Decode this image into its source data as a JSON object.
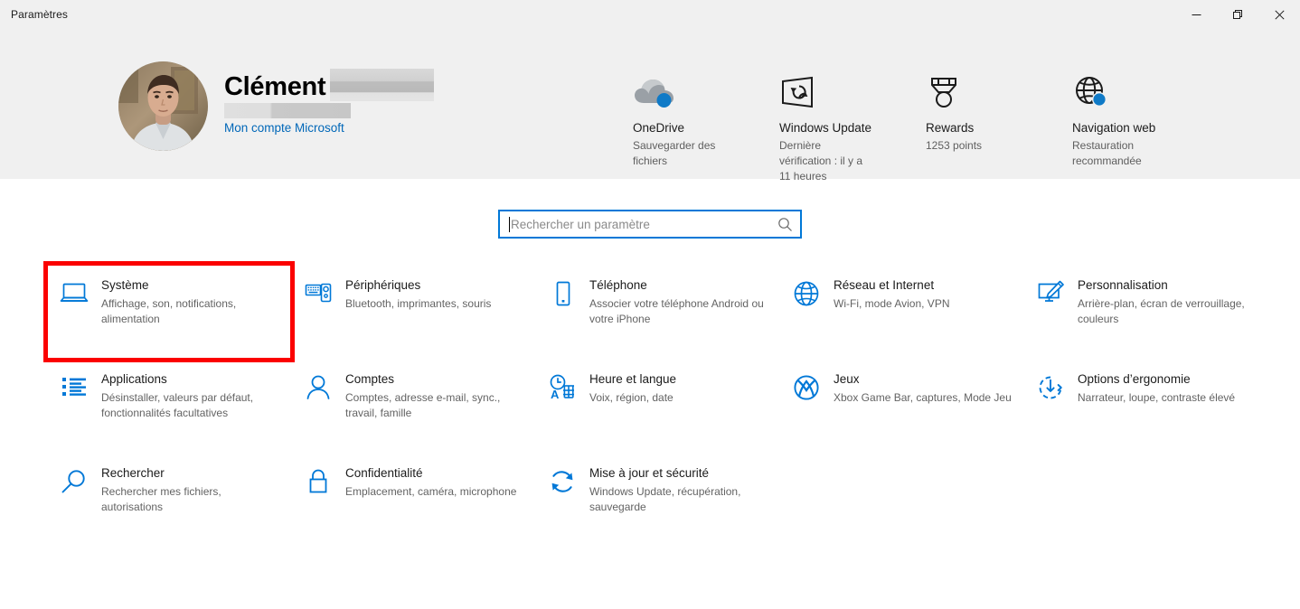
{
  "window": {
    "title": "Paramètres",
    "controls": [
      {
        "name": "minimize",
        "glyph": "minimize-icon"
      },
      {
        "name": "maximize",
        "glyph": "restore-icon"
      },
      {
        "name": "close",
        "glyph": "close-icon"
      }
    ]
  },
  "account": {
    "name": "Clément",
    "link_label": "Mon compte Microsoft",
    "avatar_alt": "user-avatar-photo",
    "redacted_surname": "",
    "redacted_email": ""
  },
  "shortcuts": [
    {
      "icon": "onedrive-cloud-icon",
      "title": "OneDrive",
      "subtitle": "Sauvegarder des fichiers"
    },
    {
      "icon": "windows-update-screen-icon",
      "title": "Windows Update",
      "subtitle": "Dernière vérification : il y a 11 heures"
    },
    {
      "icon": "rewards-medal-icon",
      "title": "Rewards",
      "subtitle": "1253 points"
    },
    {
      "icon": "web-browsing-globe-icon",
      "title": "Navigation web",
      "subtitle": "Restauration recommandée"
    }
  ],
  "search": {
    "placeholder": "Rechercher un paramètre",
    "value": "",
    "icon": "search-icon"
  },
  "tiles": [
    {
      "icon": "laptop-icon",
      "title": "Système",
      "subtitle": "Affichage, son, notifications, alimentation",
      "highlighted": true
    },
    {
      "icon": "devices-icon",
      "title": "Périphériques",
      "subtitle": "Bluetooth, imprimantes, souris",
      "highlighted": false
    },
    {
      "icon": "phone-icon",
      "title": "Téléphone",
      "subtitle": "Associer votre téléphone Android ou votre iPhone",
      "highlighted": false
    },
    {
      "icon": "globe-icon",
      "title": "Réseau et Internet",
      "subtitle": "Wi-Fi, mode Avion, VPN",
      "highlighted": false
    },
    {
      "icon": "personalization-brush-icon",
      "title": "Personnalisation",
      "subtitle": "Arrière-plan, écran de verrouillage, couleurs",
      "highlighted": false
    },
    {
      "icon": "apps-list-icon",
      "title": "Applications",
      "subtitle": "Désinstaller, valeurs par défaut, fonctionnalités facultatives",
      "highlighted": false
    },
    {
      "icon": "account-person-icon",
      "title": "Comptes",
      "subtitle": "Comptes, adresse e-mail, sync., travail, famille",
      "highlighted": false
    },
    {
      "icon": "time-language-icon",
      "title": "Heure et langue",
      "subtitle": "Voix, région, date",
      "highlighted": false
    },
    {
      "icon": "xbox-gaming-icon",
      "title": "Jeux",
      "subtitle": "Xbox Game Bar, captures, Mode Jeu",
      "highlighted": false
    },
    {
      "icon": "ease-of-access-icon",
      "title": "Options d’ergonomie",
      "subtitle": "Narrateur, loupe, contraste élevé",
      "highlighted": false
    },
    {
      "icon": "magnifier-icon",
      "title": "Rechercher",
      "subtitle": "Rechercher mes fichiers, autorisations",
      "highlighted": false
    },
    {
      "icon": "lock-icon",
      "title": "Confidentialité",
      "subtitle": "Emplacement, caméra, microphone",
      "highlighted": false
    },
    {
      "icon": "update-security-icon",
      "title": "Mise à jour et sécurité",
      "subtitle": "Windows Update, récupération, sauvegarde",
      "highlighted": false
    }
  ],
  "colors": {
    "accent": "#0078d7",
    "link": "#0067b8",
    "header_bg": "#f0f0f0",
    "highlight_outline": "#fb0101",
    "icon_blue": "#0078d7"
  }
}
